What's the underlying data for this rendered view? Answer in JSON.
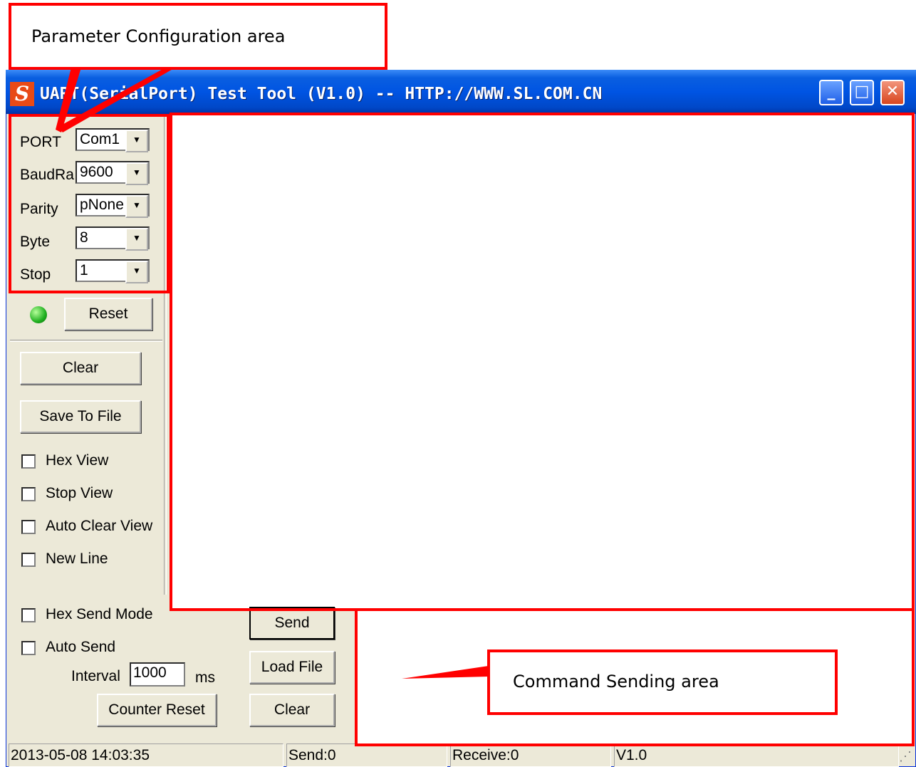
{
  "window": {
    "title": "UART(SerialPort) Test Tool (V1.0) -- HTTP://WWW.SL.COM.CN",
    "icon_letter": "S",
    "controls": {
      "minimize": "_",
      "maximize": "□",
      "close": "✕"
    }
  },
  "params": {
    "port_label": "PORT",
    "port_value": "Com1",
    "baud_label": "BaudRa",
    "baud_value": "9600",
    "parity_label": "Parity",
    "parity_value": "pNone",
    "byte_label": "Byte",
    "byte_value": "8",
    "stop_label": "Stop",
    "stop_value": "1",
    "dropdown_arrow": "▼"
  },
  "buttons": {
    "reset": "Reset",
    "clear_view": "Clear",
    "save_to_file": "Save To File",
    "send": "Send",
    "load_file": "Load File",
    "clear_send": "Clear",
    "counter_reset": "Counter Reset"
  },
  "options": {
    "hex_view": "Hex View",
    "stop_view": "Stop View",
    "auto_clear_view": "Auto Clear View",
    "new_line": "New Line",
    "hex_send_mode": "Hex Send Mode",
    "auto_send": "Auto Send"
  },
  "interval": {
    "label": "Interval",
    "value": "1000",
    "unit": "ms"
  },
  "status_bar": {
    "datetime": "2013-05-08 14:03:35",
    "send": "Send:0",
    "receive": "Receive:0",
    "version": "V1.0"
  },
  "annotations": {
    "param_area": "Parameter Configuration area",
    "command_area": "Command Sending area",
    "color": "#ff0000"
  }
}
